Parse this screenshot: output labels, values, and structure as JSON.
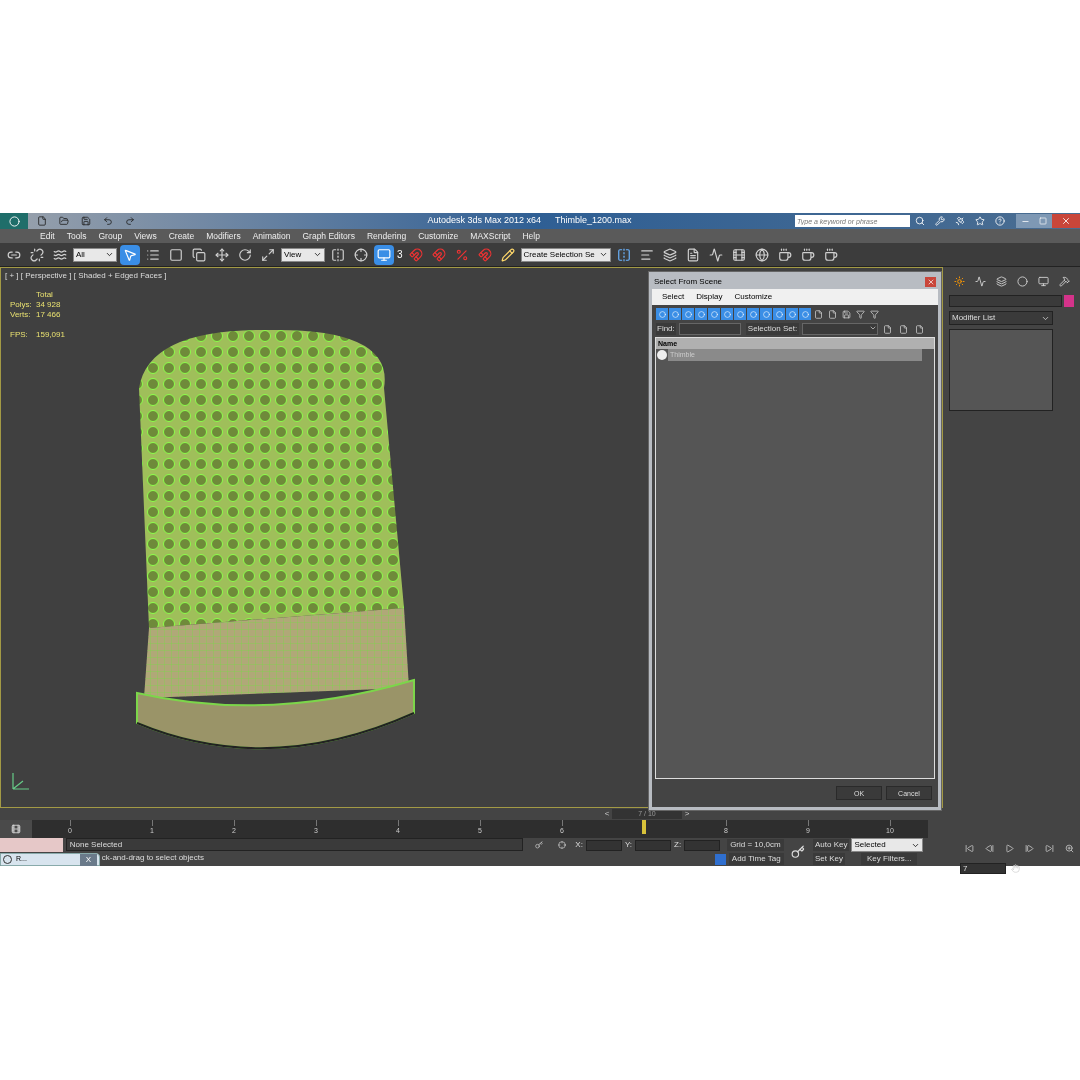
{
  "title_bar": {
    "app": "Autodesk 3ds Max  2012 x64",
    "file": "Thimble_1200.max",
    "search": {
      "placeholder": "Type a keyword or phrase"
    }
  },
  "menu": [
    "Edit",
    "Tools",
    "Group",
    "Views",
    "Create",
    "Modifiers",
    "Animation",
    "Graph Editors",
    "Rendering",
    "Customize",
    "MAXScript",
    "Help"
  ],
  "toolbar": {
    "selection_filter": "All",
    "reference_coord": "View",
    "named_selection": "Create Selection Se",
    "snap_label": "3"
  },
  "viewport": {
    "label": "[ + ] [ Perspective ] [ Shaded + Edged Faces ]",
    "stats_header": "Total",
    "stats": [
      {
        "label": "Polys:",
        "value": "34 928"
      },
      {
        "label": "Verts:",
        "value": "17 466"
      }
    ],
    "fps": {
      "label": "FPS:",
      "value": "159,091"
    }
  },
  "dialog": {
    "title": "Select From Scene",
    "menu": [
      "Select",
      "Display",
      "Customize"
    ],
    "filters": [
      {
        "on": true
      },
      {
        "on": true
      },
      {
        "on": true
      },
      {
        "on": true
      },
      {
        "on": true
      },
      {
        "on": true
      },
      {
        "on": true
      },
      {
        "on": true
      },
      {
        "on": true
      },
      {
        "on": true
      },
      {
        "on": true
      },
      {
        "on": true
      }
    ],
    "find_label": "Find:",
    "selection_set_label": "Selection Set:",
    "columns": [
      "Name"
    ],
    "rows": [
      {
        "name": "Thimble",
        "selected": true
      }
    ],
    "buttons": [
      "OK",
      "Cancel"
    ]
  },
  "command_panel": {
    "modifier_list": "Modifier List"
  },
  "time_slider": {
    "prev": "<",
    "label": "7 / 10",
    "next": ">"
  },
  "track_bar": {
    "ticks": [
      {
        "label": "0",
        "current": false
      },
      {
        "label": "1",
        "current": false
      },
      {
        "label": "2",
        "current": false
      },
      {
        "label": "3",
        "current": false
      },
      {
        "label": "4",
        "current": false
      },
      {
        "label": "5",
        "current": false
      },
      {
        "label": "6",
        "current": false
      },
      {
        "current": true
      },
      {
        "label": "8",
        "current": false
      },
      {
        "label": "9",
        "current": false
      },
      {
        "label": "10",
        "current": false
      }
    ]
  },
  "status": {
    "selection": "None Selected",
    "prompt": "ck-and-drag to select objects",
    "coords": [
      "X:",
      "Y:",
      "Z:"
    ],
    "grid": "Grid = 10,0cm",
    "time_tag": "Add Time Tag",
    "auto_key": "Auto Key",
    "key_mode": "Selected",
    "set_key": "Set Key",
    "key_filters": "Key Filters...",
    "frame": "7"
  },
  "taskbar": {
    "item": "R...",
    "close": "X"
  }
}
